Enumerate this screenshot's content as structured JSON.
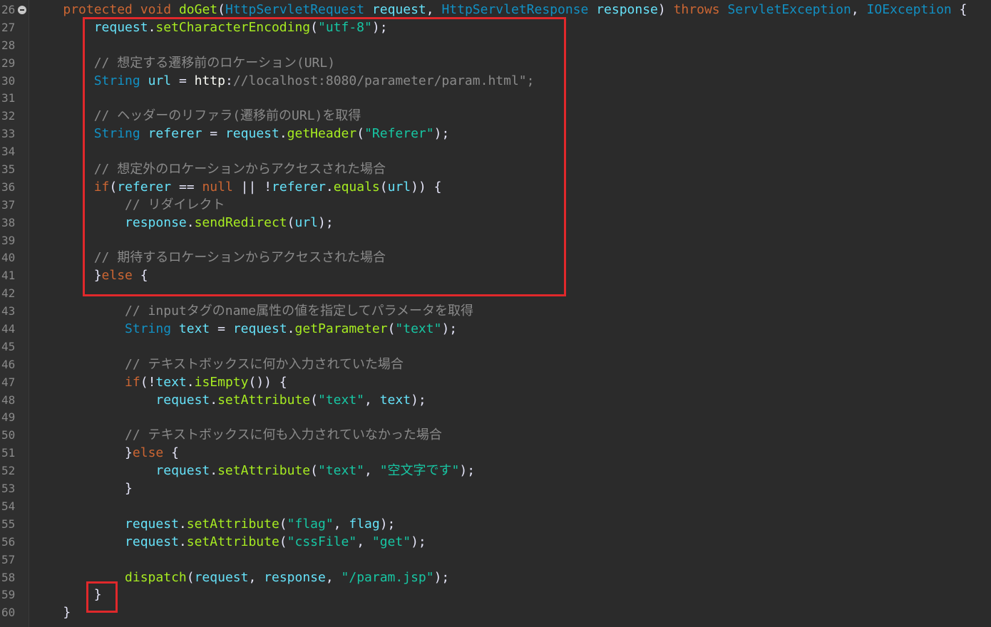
{
  "editor": {
    "language": "java",
    "colors": {
      "background": "#2b2b2b",
      "keyword": "#cc6633",
      "method": "#a7ec21",
      "type": "#1290c3",
      "string": "#17c6a3",
      "comment": "#8a8a8a",
      "variable": "#66e1f8",
      "highlight_box": "#e0282b"
    },
    "fold_icon": "collapse-fold-icon",
    "lines": [
      {
        "n": "26",
        "code": "    protected void doGet(HttpServletRequest request, HttpServletResponse response) throws ServletException, IOException {"
      },
      {
        "n": "27",
        "code": "        request.setCharacterEncoding(\"utf-8\");"
      },
      {
        "n": "28",
        "code": ""
      },
      {
        "n": "29",
        "code": "        // 想定する遷移前のロケーション(URL)"
      },
      {
        "n": "30",
        "code": "        String url = \"http://localhost:8080/parameter/param.html\";"
      },
      {
        "n": "31",
        "code": ""
      },
      {
        "n": "32",
        "code": "        // ヘッダーのリファラ(遷移前のURL)を取得"
      },
      {
        "n": "33",
        "code": "        String referer = request.getHeader(\"Referer\");"
      },
      {
        "n": "34",
        "code": ""
      },
      {
        "n": "35",
        "code": "        // 想定外のロケーションからアクセスされた場合"
      },
      {
        "n": "36",
        "code": "        if(referer == null || !referer.equals(url)) {"
      },
      {
        "n": "37",
        "code": "            // リダイレクト"
      },
      {
        "n": "38",
        "code": "            response.sendRedirect(url);"
      },
      {
        "n": "39",
        "code": ""
      },
      {
        "n": "40",
        "code": "        // 期待するロケーションからアクセスされた場合"
      },
      {
        "n": "41",
        "code": "        }else {"
      },
      {
        "n": "42",
        "code": ""
      },
      {
        "n": "43",
        "code": "            // inputタグのname属性の値を指定してパラメータを取得"
      },
      {
        "n": "44",
        "code": "            String text = request.getParameter(\"text\");"
      },
      {
        "n": "45",
        "code": ""
      },
      {
        "n": "46",
        "code": "            // テキストボックスに何か入力されていた場合"
      },
      {
        "n": "47",
        "code": "            if(!text.isEmpty()) {"
      },
      {
        "n": "48",
        "code": "                request.setAttribute(\"text\", text);"
      },
      {
        "n": "49",
        "code": ""
      },
      {
        "n": "50",
        "code": "            // テキストボックスに何も入力されていなかった場合"
      },
      {
        "n": "51",
        "code": "            }else {"
      },
      {
        "n": "52",
        "code": "                request.setAttribute(\"text\", \"空文字です\");"
      },
      {
        "n": "53",
        "code": "            }"
      },
      {
        "n": "54",
        "code": ""
      },
      {
        "n": "55",
        "code": "            request.setAttribute(\"flag\", flag);"
      },
      {
        "n": "56",
        "code": "            request.setAttribute(\"cssFile\", \"get\");"
      },
      {
        "n": "57",
        "code": ""
      },
      {
        "n": "58",
        "code": "            dispatch(request, response, \"/param.jsp\");"
      },
      {
        "n": "59",
        "code": "        }"
      },
      {
        "n": "60",
        "code": "    }"
      }
    ]
  }
}
